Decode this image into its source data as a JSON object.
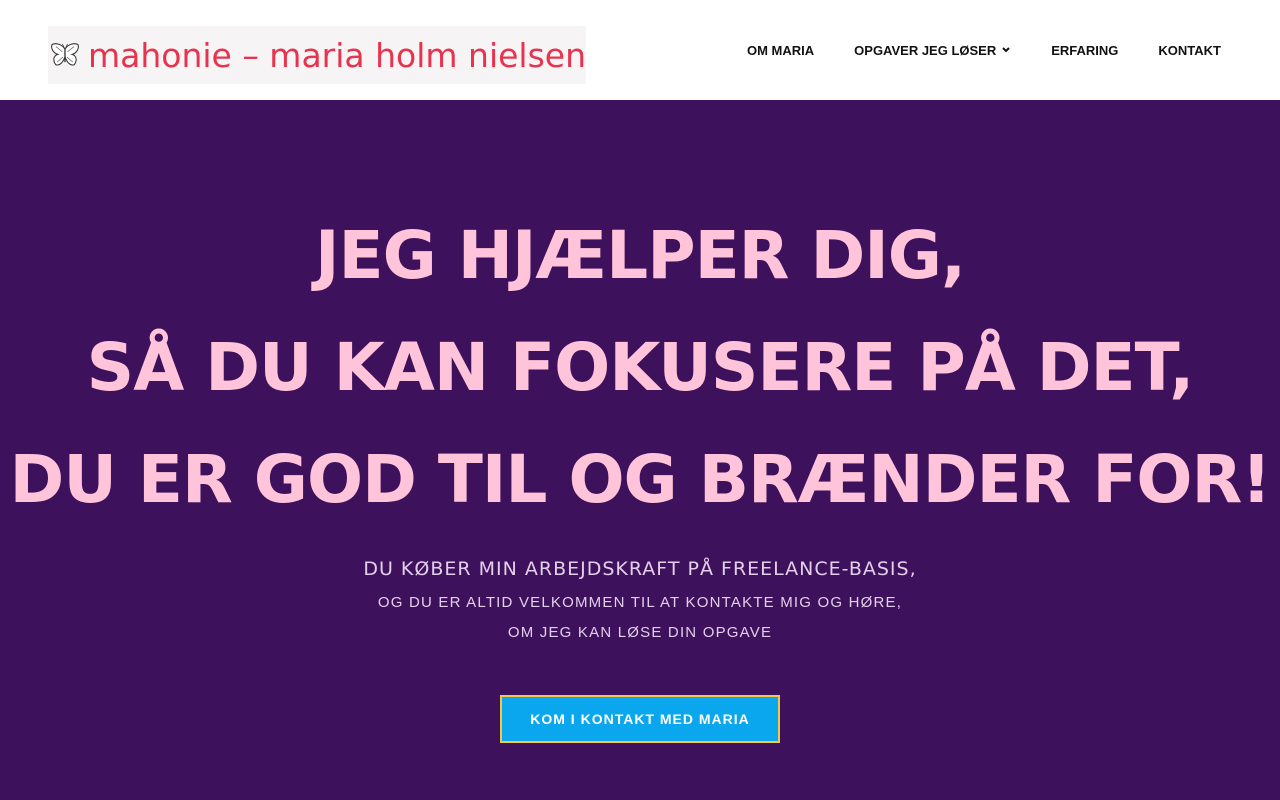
{
  "brand": {
    "logo_text": "mahonie – maria holm nielsen",
    "logo_icon": "butterfly-icon",
    "text_color": "#e8334e"
  },
  "nav": {
    "items": [
      {
        "label": "OM MARIA",
        "has_dropdown": false
      },
      {
        "label": "OPGAVER JEG LØSER",
        "has_dropdown": true
      },
      {
        "label": "ERFARING",
        "has_dropdown": false
      },
      {
        "label": "KONTAKT",
        "has_dropdown": false
      }
    ]
  },
  "hero": {
    "background": "#3d115c",
    "headline": [
      "JEG HJÆLPER DIG,",
      "SÅ DU KAN FOKUSERE PÅ DET,",
      "DU ER GOD TIL OG BRÆNDER FOR!"
    ],
    "headline_color": "#ffc4da",
    "subline_main": "DU KØBER MIN ARBEJDSKRAFT PÅ FREELANCE-BASIS,",
    "subline_2": "OG DU ER ALTID VELKOMMEN TIL AT KONTAKTE MIG OG HØRE,",
    "subline_3": "OM JEG KAN LØSE DIN OPGAVE",
    "cta_label": "KOM I KONTAKT MED MARIA",
    "cta_color": "#0aa7ee",
    "cta_border_color": "#f2c84b"
  }
}
